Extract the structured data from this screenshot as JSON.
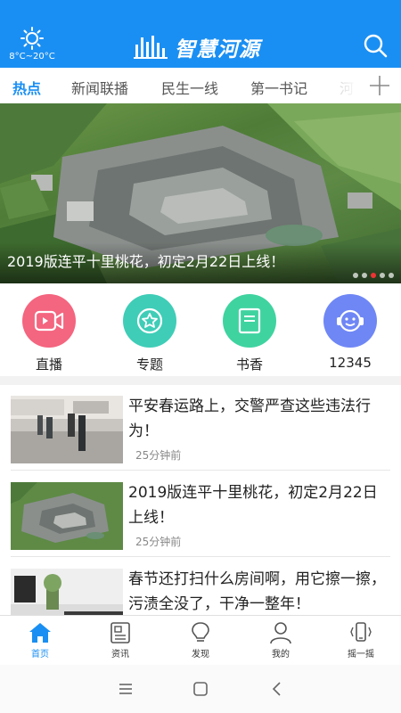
{
  "header": {
    "weather_temp": "8°C~20°C",
    "logo_text": "智慧河源",
    "brand_color": "#1a8ff3"
  },
  "tabs": [
    {
      "label": "热点",
      "active": true
    },
    {
      "label": "新闻联播",
      "active": false
    },
    {
      "label": "民生一线",
      "active": false
    },
    {
      "label": "第一书记",
      "active": false
    },
    {
      "label": "河",
      "active": false
    }
  ],
  "banner": {
    "caption": "2019版连平十里桃花，初定2月22日上线！",
    "slide_count": 5,
    "active_slide": 3
  },
  "quick_links": [
    {
      "label": "直播",
      "icon": "video-camera-icon",
      "color": "#f4657f"
    },
    {
      "label": "专题",
      "icon": "star-icon",
      "color": "#3fcdb7"
    },
    {
      "label": "书香",
      "icon": "book-icon",
      "color": "#3fd3a0"
    },
    {
      "label": "12345",
      "icon": "hotline-face-icon",
      "color": "#6f87f5"
    }
  ],
  "news": [
    {
      "title": "平安春运路上，交警严查这些违法行为！",
      "time": "25分钟前"
    },
    {
      "title": "2019版连平十里桃花，初定2月22日上线！",
      "time": "25分钟前"
    },
    {
      "title": "春节还打扫什么房间啊，用它擦一擦，污渍全没了，干净一整年！",
      "time": ""
    }
  ],
  "bottom_nav": [
    {
      "label": "首页",
      "icon": "home-icon",
      "active": true
    },
    {
      "label": "资讯",
      "icon": "newspaper-icon",
      "active": false
    },
    {
      "label": "发现",
      "icon": "lightbulb-icon",
      "active": false
    },
    {
      "label": "我的",
      "icon": "person-icon",
      "active": false
    },
    {
      "label": "摇一摇",
      "icon": "phone-shake-icon",
      "active": false
    }
  ]
}
